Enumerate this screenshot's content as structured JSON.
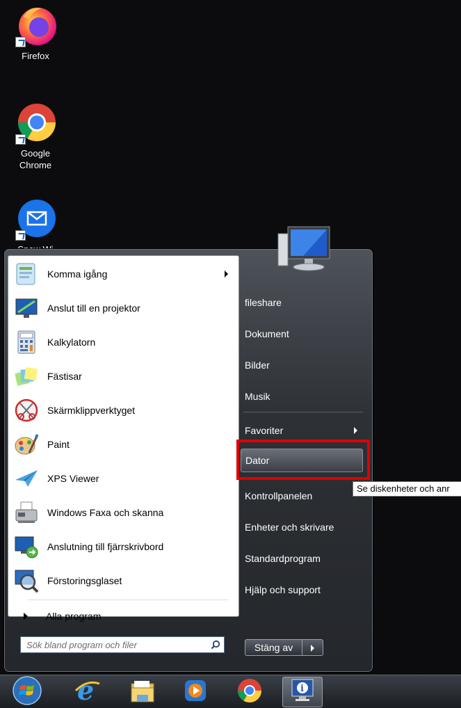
{
  "desktop": {
    "icons": [
      {
        "label": "Firefox",
        "icon": "firefox-icon"
      },
      {
        "label": "Google Chrome",
        "icon": "chrome-icon"
      },
      {
        "label": "Snow Wi",
        "icon": "mail-icon"
      }
    ]
  },
  "start_menu": {
    "programs": [
      {
        "label": "Komma igång",
        "icon": "getting-started-icon",
        "has_submenu": true
      },
      {
        "label": "Anslut till en projektor",
        "icon": "projector-icon",
        "has_submenu": false
      },
      {
        "label": "Kalkylatorn",
        "icon": "calculator-icon",
        "has_submenu": false
      },
      {
        "label": "Fästisar",
        "icon": "sticky-notes-icon",
        "has_submenu": false
      },
      {
        "label": "Skärmklippverktyget",
        "icon": "snipping-tool-icon",
        "has_submenu": false
      },
      {
        "label": "Paint",
        "icon": "paint-icon",
        "has_submenu": false
      },
      {
        "label": "XPS Viewer",
        "icon": "xps-viewer-icon",
        "has_submenu": false
      },
      {
        "label": "Windows Faxa och skanna",
        "icon": "fax-scan-icon",
        "has_submenu": false
      },
      {
        "label": "Anslutning till fjärrskrivbord",
        "icon": "remote-desktop-icon",
        "has_submenu": false
      },
      {
        "label": "Förstoringsglaset",
        "icon": "magnifier-icon",
        "has_submenu": false
      }
    ],
    "all_programs_label": "Alla program",
    "search": {
      "placeholder": "Sök bland program och filer",
      "value": ""
    },
    "right_items": [
      {
        "label": "fileshare",
        "has_submenu": false
      },
      {
        "label": "Dokument",
        "has_submenu": false
      },
      {
        "label": "Bilder",
        "has_submenu": false
      },
      {
        "label": "Musik",
        "has_submenu": false
      },
      {
        "label": "Favoriter",
        "has_submenu": true
      },
      {
        "label": "Dator",
        "has_submenu": false,
        "hovered": true
      },
      {
        "label": "Kontrollpanelen",
        "has_submenu": false
      },
      {
        "label": "Enheter och skrivare",
        "has_submenu": false
      },
      {
        "label": "Standardprogram",
        "has_submenu": false
      },
      {
        "label": "Hjälp och support",
        "has_submenu": false
      }
    ],
    "tooltip": "Se diskenheter och anr",
    "shutdown_label": "Stäng av"
  },
  "taskbar": {
    "items": [
      {
        "icon": "start-orb-icon"
      },
      {
        "icon": "internet-explorer-icon"
      },
      {
        "icon": "file-explorer-icon"
      },
      {
        "icon": "media-player-icon"
      },
      {
        "icon": "chrome-icon"
      },
      {
        "icon": "system-info-icon",
        "active": true
      }
    ]
  },
  "colors": {
    "highlight": "#e00000",
    "desktop_bg": "#0c0c0e"
  }
}
